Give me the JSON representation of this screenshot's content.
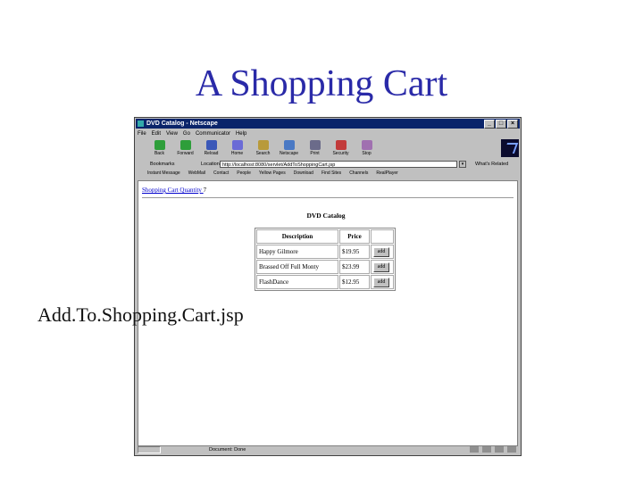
{
  "slide": {
    "title": "A Shopping Cart",
    "caption": "Add.To.Shopping.Cart.jsp"
  },
  "window": {
    "title": "DVD Catalog - Netscape",
    "controls": {
      "minimize": "_",
      "maximize": "□",
      "close": "×"
    }
  },
  "menu": [
    "File",
    "Edit",
    "View",
    "Go",
    "Communicator",
    "Help"
  ],
  "toolbar": [
    {
      "label": "Back",
      "icon": "back-arrow-icon",
      "color": "#2e9e3a"
    },
    {
      "label": "Forward",
      "icon": "forward-arrow-icon",
      "color": "#2e9e3a"
    },
    {
      "label": "Reload",
      "icon": "reload-icon",
      "color": "#3b58b8"
    },
    {
      "label": "Home",
      "icon": "home-icon",
      "color": "#6b6bd6"
    },
    {
      "label": "Search",
      "icon": "search-icon",
      "color": "#b89a3b"
    },
    {
      "label": "Netscape",
      "icon": "netscape-icon",
      "color": "#4a79c4"
    },
    {
      "label": "Print",
      "icon": "print-icon",
      "color": "#6b6b8a"
    },
    {
      "label": "Security",
      "icon": "lock-icon",
      "color": "#c23b3b"
    },
    {
      "label": "Stop",
      "icon": "stop-icon",
      "color": "#a070b0"
    }
  ],
  "location": {
    "bookmarks_label": "Bookmarks",
    "location_label": "Location:",
    "url": "http://localhost:8080/servlet/AddToShoppingCart.jsp",
    "whats_related": "What's Related"
  },
  "personal_toolbar": [
    "Instant Message",
    "WebMail",
    "Contact",
    "People",
    "Yellow Pages",
    "Download",
    "Find Sites",
    "Channels",
    "RealPlayer"
  ],
  "page": {
    "cart_link": "Shopping Cart Quantity",
    "cart_quantity": "7",
    "catalog_title": "DVD Catalog",
    "table": {
      "headers": [
        "Description",
        "Price"
      ],
      "rows": [
        {
          "description": "Happy Gilmore",
          "price": "$19.95",
          "button": "add"
        },
        {
          "description": "Brassed Off Full Monty",
          "price": "$23.99",
          "button": "add"
        },
        {
          "description": "FlashDance",
          "price": "$12.95",
          "button": "add"
        }
      ]
    }
  },
  "status": {
    "text": "Document: Done"
  }
}
